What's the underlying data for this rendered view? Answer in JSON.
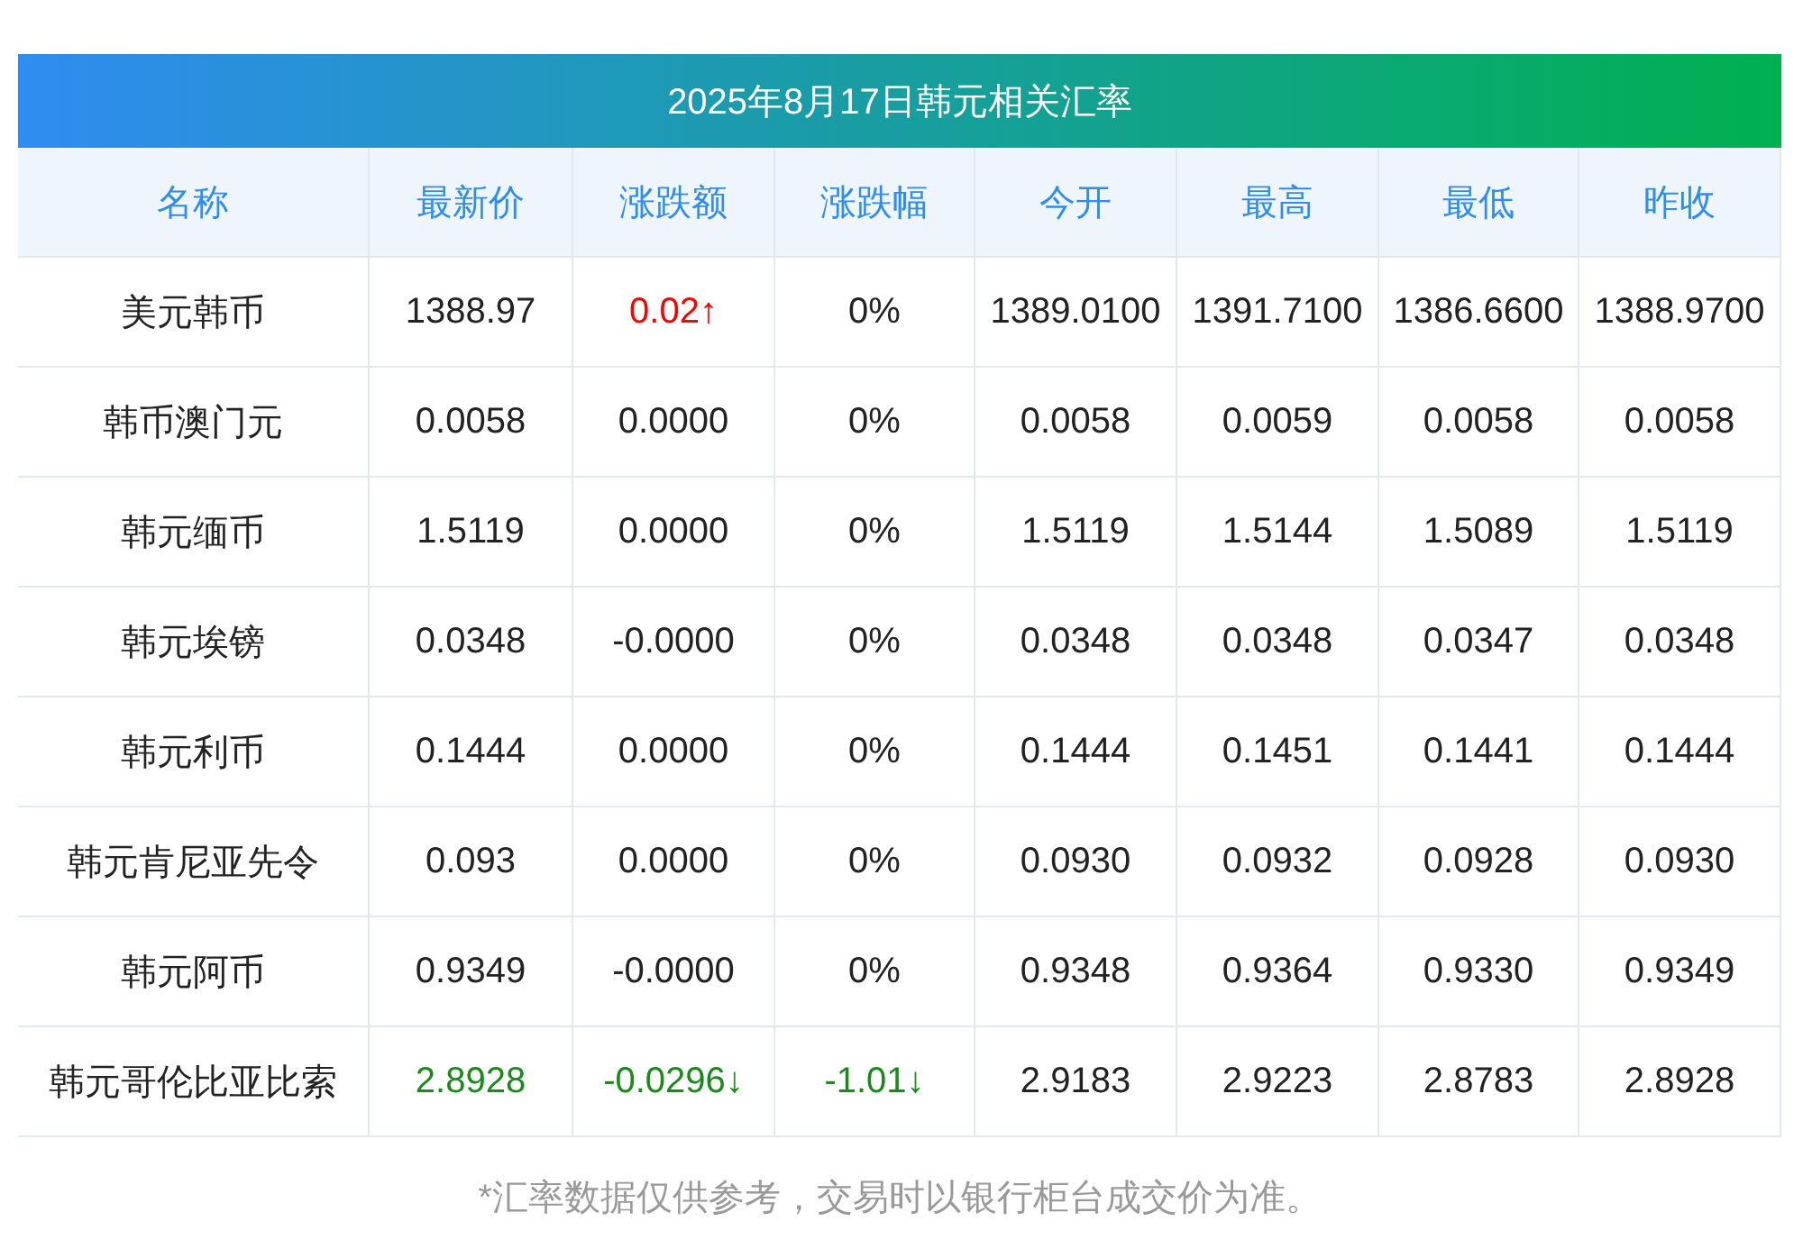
{
  "title": "2025年8月17日韩元相关汇率",
  "columns": [
    "名称",
    "最新价",
    "涨跌额",
    "涨跌幅",
    "今开",
    "最高",
    "最低",
    "昨收"
  ],
  "rows": [
    {
      "cells": [
        {
          "text": "美元韩币"
        },
        {
          "text": "1388.97"
        },
        {
          "text": "0.02↑",
          "color": "#ff0000"
        },
        {
          "text": "0%"
        },
        {
          "text": "1389.0100"
        },
        {
          "text": "1391.7100"
        },
        {
          "text": "1386.6600"
        },
        {
          "text": "1388.9700"
        }
      ]
    },
    {
      "cells": [
        {
          "text": "韩币澳门元"
        },
        {
          "text": "0.0058"
        },
        {
          "text": "0.0000"
        },
        {
          "text": "0%"
        },
        {
          "text": "0.0058"
        },
        {
          "text": "0.0059"
        },
        {
          "text": "0.0058"
        },
        {
          "text": "0.0058"
        }
      ]
    },
    {
      "cells": [
        {
          "text": "韩元缅币"
        },
        {
          "text": "1.5119"
        },
        {
          "text": "0.0000"
        },
        {
          "text": "0%"
        },
        {
          "text": "1.5119"
        },
        {
          "text": "1.5144"
        },
        {
          "text": "1.5089"
        },
        {
          "text": "1.5119"
        }
      ]
    },
    {
      "cells": [
        {
          "text": "韩元埃镑"
        },
        {
          "text": "0.0348"
        },
        {
          "text": "-0.0000"
        },
        {
          "text": "0%"
        },
        {
          "text": "0.0348"
        },
        {
          "text": "0.0348"
        },
        {
          "text": "0.0347"
        },
        {
          "text": "0.0348"
        }
      ]
    },
    {
      "cells": [
        {
          "text": "韩元利币"
        },
        {
          "text": "0.1444"
        },
        {
          "text": "0.0000"
        },
        {
          "text": "0%"
        },
        {
          "text": "0.1444"
        },
        {
          "text": "0.1451"
        },
        {
          "text": "0.1441"
        },
        {
          "text": "0.1444"
        }
      ]
    },
    {
      "cells": [
        {
          "text": "韩元肯尼亚先令"
        },
        {
          "text": "0.093"
        },
        {
          "text": "0.0000"
        },
        {
          "text": "0%"
        },
        {
          "text": "0.0930"
        },
        {
          "text": "0.0932"
        },
        {
          "text": "0.0928"
        },
        {
          "text": "0.0930"
        }
      ]
    },
    {
      "cells": [
        {
          "text": "韩元阿币"
        },
        {
          "text": "0.9349"
        },
        {
          "text": "-0.0000"
        },
        {
          "text": "0%"
        },
        {
          "text": "0.9348"
        },
        {
          "text": "0.9364"
        },
        {
          "text": "0.9330"
        },
        {
          "text": "0.9349"
        }
      ]
    },
    {
      "cells": [
        {
          "text": "韩元哥伦比亚比索"
        },
        {
          "text": "2.8928",
          "color": "#1a8a1a"
        },
        {
          "text": "-0.0296↓",
          "color": "#1a8a1a"
        },
        {
          "text": "-1.01↓",
          "color": "#1a8a1a"
        },
        {
          "text": "2.9183"
        },
        {
          "text": "2.9223"
        },
        {
          "text": "2.8783"
        },
        {
          "text": "2.8928"
        }
      ]
    }
  ],
  "footnote": "*汇率数据仅供参考，交易时以银行柜台成交价为准。"
}
